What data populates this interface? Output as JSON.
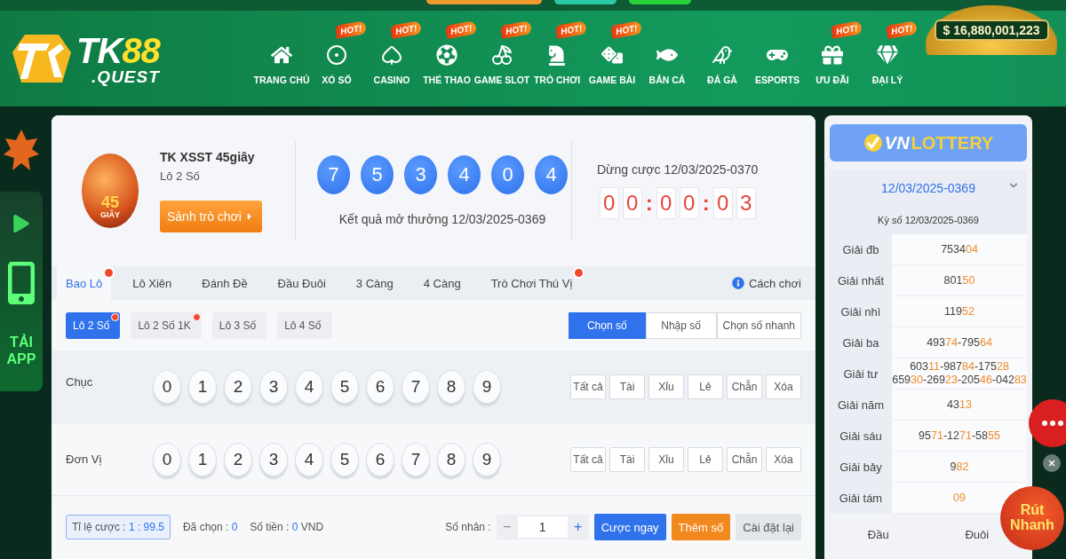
{
  "jackpot": "$ 16,880,001,223",
  "logo": {
    "main": "TK",
    "accent": "88",
    "sub": ".QUEST"
  },
  "nav": [
    {
      "label": "TRANG CHỦ"
    },
    {
      "label": "XỔ SỐ",
      "badge": "HOT!"
    },
    {
      "label": "CASINO",
      "badge": "HOT!"
    },
    {
      "label": "THỂ THAO",
      "badge": "HOT!"
    },
    {
      "label": "GAME SLOT",
      "badge": "HOT!"
    },
    {
      "label": "TRÒ CHƠI",
      "badge": "HOT!"
    },
    {
      "label": "GAME BÀI",
      "badge": "HOT!"
    },
    {
      "label": "BẮN CÁ"
    },
    {
      "label": "ĐÁ GÀ"
    },
    {
      "label": "ESPORTS"
    },
    {
      "label": "ƯU ĐÃI",
      "badge": "HOT!"
    },
    {
      "label": "ĐẠI LÝ",
      "badge": "HOT!"
    }
  ],
  "side_banner": {
    "lines": [
      "TẢI",
      "APP"
    ]
  },
  "game": {
    "badge_number": "45",
    "badge_unit": "GIÂY",
    "title": "TK XSST 45giây",
    "subtitle": "Lô 2 Số",
    "lobby_button": "Sảnh trò chơi",
    "balls": [
      "7",
      "5",
      "3",
      "4",
      "0",
      "4"
    ],
    "result_caption": "Kết quả mở thưởng 12/03/2025-0369",
    "stop_label": "Dừng cược 12/03/2025-0370",
    "countdown": [
      [
        "0",
        "0"
      ],
      [
        "0",
        "0"
      ],
      [
        "0",
        "3"
      ]
    ],
    "countdown_separator": ":"
  },
  "tabs": [
    {
      "label": "Bao Lô",
      "selected": true,
      "hot": true
    },
    {
      "label": "Lô Xiên",
      "selected": false,
      "hot": false
    },
    {
      "label": "Đánh Đề",
      "selected": false,
      "hot": false
    },
    {
      "label": "Đầu Đuôi",
      "selected": false,
      "hot": false
    },
    {
      "label": "3 Càng",
      "selected": false,
      "hot": false
    },
    {
      "label": "4 Càng",
      "selected": false,
      "hot": false
    },
    {
      "label": "Trò Chơi Thú Vị",
      "selected": false,
      "hot": true
    }
  ],
  "help_link": "Cách chơi",
  "subtabs": [
    {
      "label": "Lô 2 Số",
      "selected": true,
      "hot": true
    },
    {
      "label": "Lô 2 Số 1K",
      "selected": false,
      "hot": true
    },
    {
      "label": "Lô 3 Số",
      "selected": false,
      "hot": false
    },
    {
      "label": "Lô 4 Số",
      "selected": false,
      "hot": false
    }
  ],
  "modes": [
    {
      "label": "Chọn số",
      "selected": true
    },
    {
      "label": "Nhập số",
      "selected": false
    },
    {
      "label": "Chọn số nhanh",
      "selected": false
    }
  ],
  "pick_rows": [
    {
      "label": "Chục",
      "digits": [
        {
          "d": "0",
          "selected": false
        },
        {
          "d": "1",
          "selected": false
        },
        {
          "d": "2",
          "selected": false
        },
        {
          "d": "3",
          "selected": false
        },
        {
          "d": "4",
          "selected": false
        },
        {
          "d": "5",
          "selected": false
        },
        {
          "d": "6",
          "selected": false
        },
        {
          "d": "7",
          "selected": false
        },
        {
          "d": "8",
          "selected": false
        },
        {
          "d": "9",
          "selected": false
        }
      ],
      "quick": [
        "Tất cả",
        "Tài",
        "Xỉu",
        "Lẻ",
        "Chẵn",
        "Xóa"
      ]
    },
    {
      "label": "Đơn Vị",
      "digits": [
        {
          "d": "0",
          "selected": false
        },
        {
          "d": "1",
          "selected": false
        },
        {
          "d": "2",
          "selected": false
        },
        {
          "d": "3",
          "selected": false
        },
        {
          "d": "4",
          "selected": false
        },
        {
          "d": "5",
          "selected": false
        },
        {
          "d": "6",
          "selected": false
        },
        {
          "d": "7",
          "selected": false
        },
        {
          "d": "8",
          "selected": false
        },
        {
          "d": "9",
          "selected": false
        }
      ],
      "quick": [
        "Tất cả",
        "Tài",
        "Xỉu",
        "Lẻ",
        "Chẵn",
        "Xóa"
      ]
    }
  ],
  "footer": {
    "odds_label": "Tỉ lệ cược :",
    "odds_value": "1 : 99.5",
    "chosen_label": "Đã chọn :",
    "chosen_value": "0",
    "amount_label": "Số tiền :",
    "amount_value": "0",
    "amount_unit": "VND",
    "multiplier_label": "Số nhân :",
    "minus": "−",
    "multiplier": "1",
    "plus": "+",
    "bet_button": "Cược ngay",
    "add_button": "Thêm số",
    "reset_button": "Cài đặt lại"
  },
  "results": {
    "brand_a": "VN",
    "brand_b": "LOTTERY",
    "draw_select": "12/03/2025-0369",
    "draw_caption": "Kỳ số 12/03/2025-0369",
    "prizes": [
      {
        "name": "Giải đb",
        "lines": [
          [
            {
              "text": "7534",
              "highlight": false
            },
            {
              "text": "04",
              "highlight": true
            }
          ]
        ]
      },
      {
        "name": "Giải nhất",
        "lines": [
          [
            {
              "text": "801",
              "highlight": false
            },
            {
              "text": "50",
              "highlight": true
            }
          ]
        ]
      },
      {
        "name": "Giải nhì",
        "lines": [
          [
            {
              "text": "119",
              "highlight": false
            },
            {
              "text": "52",
              "highlight": true
            }
          ]
        ]
      },
      {
        "name": "Giải ba",
        "lines": [
          [
            {
              "text": "493",
              "highlight": false
            },
            {
              "text": "74",
              "highlight": true
            },
            {
              "text": "-795",
              "highlight": false
            },
            {
              "text": "64",
              "highlight": true
            }
          ]
        ]
      },
      {
        "name": "Giải tư",
        "lines": [
          [
            {
              "text": "603",
              "highlight": false
            },
            {
              "text": "11",
              "highlight": true
            },
            {
              "text": "-987",
              "highlight": false
            },
            {
              "text": "84",
              "highlight": true
            },
            {
              "text": "-175",
              "highlight": false
            },
            {
              "text": "28",
              "highlight": true
            }
          ],
          [
            {
              "text": "659",
              "highlight": false
            },
            {
              "text": "30",
              "highlight": true
            },
            {
              "text": "-269",
              "highlight": false
            },
            {
              "text": "23",
              "highlight": true
            },
            {
              "text": "-205",
              "highlight": false
            },
            {
              "text": "46",
              "highlight": true
            },
            {
              "text": "-042",
              "highlight": false
            },
            {
              "text": "83",
              "highlight": true
            }
          ]
        ]
      },
      {
        "name": "Giải năm",
        "lines": [
          [
            {
              "text": "43",
              "highlight": false
            },
            {
              "text": "13",
              "highlight": true
            }
          ]
        ]
      },
      {
        "name": "Giải sáu",
        "lines": [
          [
            {
              "text": "95",
              "highlight": false
            },
            {
              "text": "71",
              "highlight": true
            },
            {
              "text": "-12",
              "highlight": false
            },
            {
              "text": "71",
              "highlight": true
            },
            {
              "text": "-58",
              "highlight": false
            },
            {
              "text": "55",
              "highlight": true
            }
          ]
        ]
      },
      {
        "name": "Giải bảy",
        "lines": [
          [
            {
              "text": "9",
              "highlight": false
            },
            {
              "text": "82",
              "highlight": true
            }
          ]
        ]
      },
      {
        "name": "Giải tám",
        "lines": [
          [
            {
              "text": "09",
              "highlight": true
            }
          ]
        ]
      }
    ],
    "columns": [
      "Đầu",
      "Đuôi"
    ]
  },
  "promo": {
    "line1": "Rút",
    "line2": "Nhanh"
  }
}
